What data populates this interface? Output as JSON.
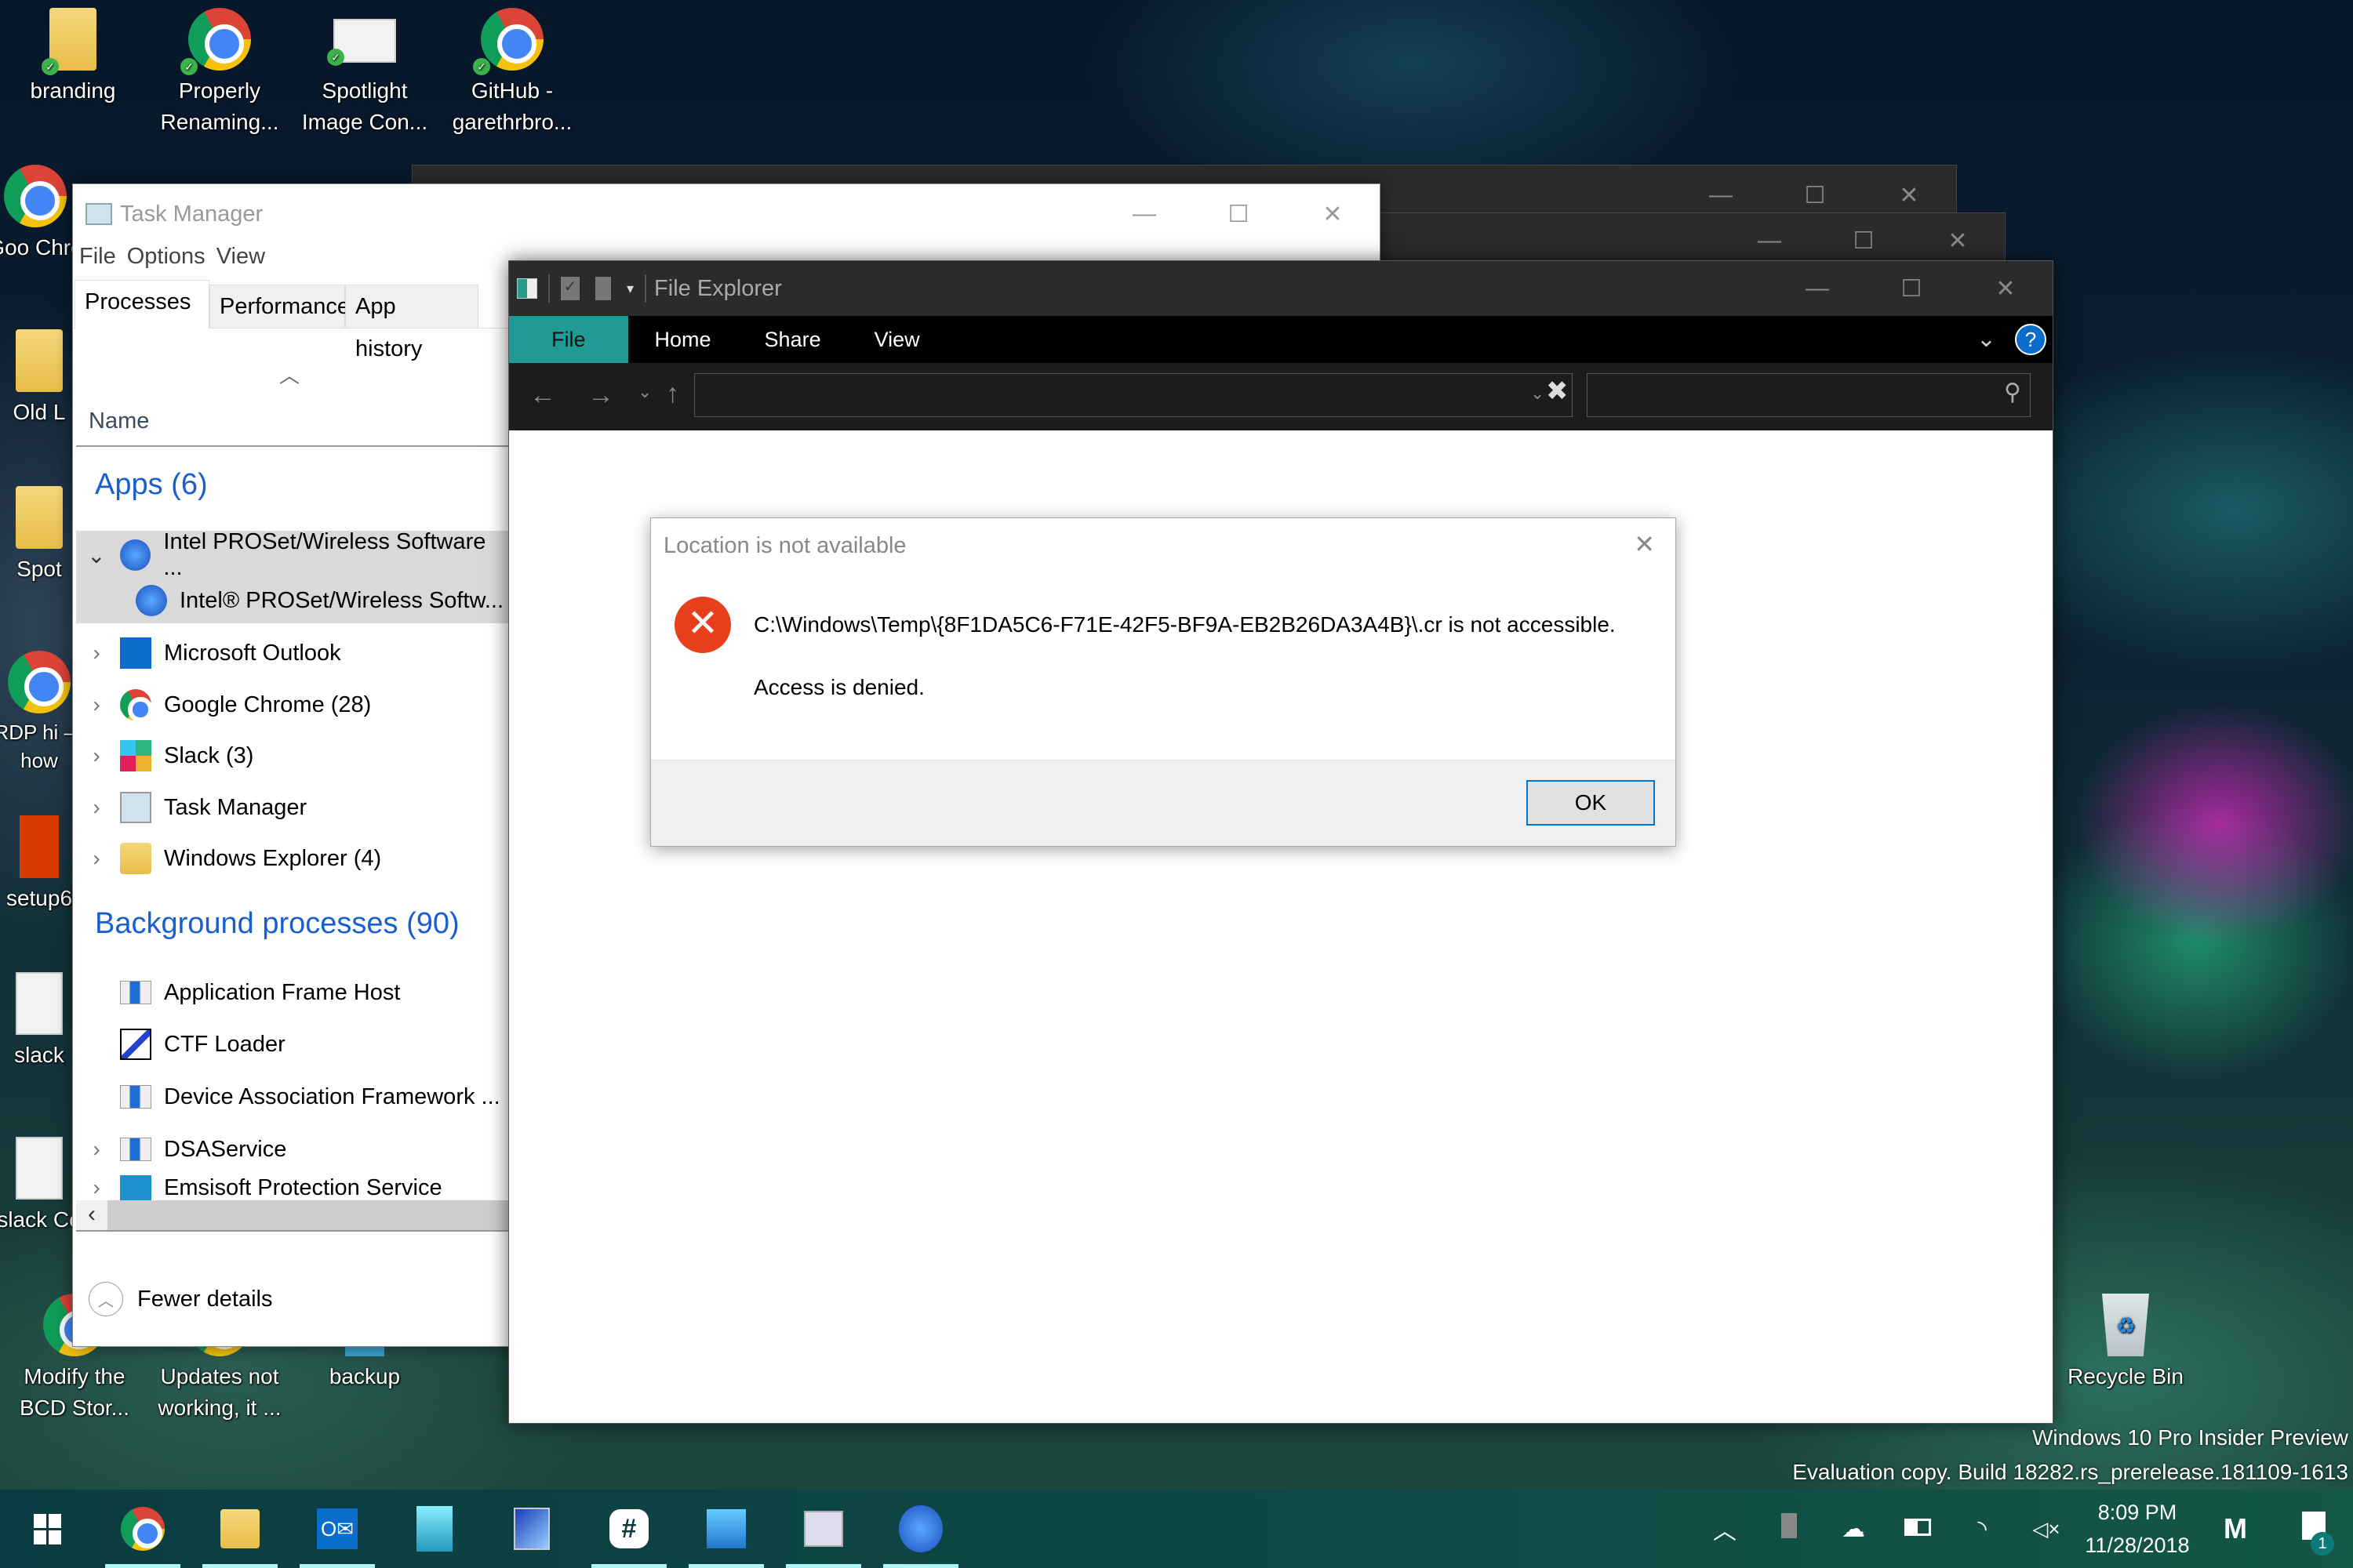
{
  "desktop": {
    "icons_top": [
      {
        "label": "branding",
        "icon": "folder-icon"
      },
      {
        "label": "Properly Renaming...",
        "icon": "chrome-icon"
      },
      {
        "label": "Spotlight Image Con...",
        "icon": "app-icon"
      },
      {
        "label": "GitHub - garethrbro...",
        "icon": "chrome-icon"
      }
    ],
    "icons_left": [
      {
        "label": "Goo Chro",
        "icon": "chrome-shortcut-icon"
      },
      {
        "label": "Old L",
        "icon": "folder-icon"
      },
      {
        "label": "Spot",
        "icon": "folder-icon"
      },
      {
        "label": "RDP hi — how",
        "icon": "chrome-icon"
      },
      {
        "label": "setup6",
        "icon": "office-icon"
      },
      {
        "label": "slack",
        "icon": "document-icon"
      },
      {
        "label": "slack Co",
        "icon": "document-icon"
      }
    ],
    "icons_bottom": [
      {
        "label": "Modify the BCD Stor...",
        "icon": "chrome-icon"
      },
      {
        "label": "Updates not working, it ...",
        "icon": "chrome-icon"
      },
      {
        "label": "backup",
        "icon": "server-icon"
      }
    ],
    "recycle_bin": {
      "label": "Recycle Bin"
    },
    "watermark": {
      "line1": "Windows 10 Pro Insider Preview",
      "line2": "Evaluation copy. Build 18282.rs_prerelease.181109-1613"
    }
  },
  "task_manager": {
    "title": "Task Manager",
    "menu": [
      "File",
      "Options",
      "View"
    ],
    "tabs": [
      "Processes",
      "Performance",
      "App history"
    ],
    "active_tab": "Processes",
    "column_name": "Name",
    "apps_group": "Apps (6)",
    "apps": [
      {
        "name": "Intel PROSet/Wireless Software ...",
        "icon": "wifi-icon",
        "expanded": true
      },
      {
        "name": "Intel® PROSet/Wireless Softw...",
        "icon": "wifi-icon",
        "child": true
      },
      {
        "name": "Microsoft Outlook",
        "icon": "outlook-icon"
      },
      {
        "name": "Google Chrome (28)",
        "icon": "chrome-icon"
      },
      {
        "name": "Slack (3)",
        "icon": "slack-icon"
      },
      {
        "name": "Task Manager",
        "icon": "task-manager-icon"
      },
      {
        "name": "Windows Explorer (4)",
        "icon": "explorer-icon"
      }
    ],
    "background_group": "Background processes (90)",
    "background": [
      {
        "name": "Application Frame Host",
        "icon": "window-icon",
        "expandable": false
      },
      {
        "name": "CTF Loader",
        "icon": "ctf-icon",
        "expandable": false
      },
      {
        "name": "Device Association Framework ...",
        "icon": "window-icon",
        "expandable": false
      },
      {
        "name": "DSAService",
        "icon": "window-icon",
        "expandable": true
      },
      {
        "name": "Emsisoft Protection Service",
        "icon": "shield-icon",
        "expandable": true
      }
    ],
    "fewer_details": "Fewer details"
  },
  "file_explorer": {
    "title": "File Explorer",
    "ribbon_tabs": [
      "File",
      "Home",
      "Share",
      "View"
    ],
    "address_value": "",
    "search_placeholder": ""
  },
  "dialog": {
    "title": "Location is not available",
    "message": "C:\\Windows\\Temp\\{8F1DA5C6-F71E-42F5-BF9A-EB2B26DA3A4B}\\.cr is not accessible.",
    "detail": "Access is denied.",
    "ok_label": "OK"
  },
  "taskbar": {
    "pinned": [
      {
        "name": "start",
        "icon": "windows-logo-icon",
        "running": false
      },
      {
        "name": "chrome",
        "icon": "chrome-icon",
        "running": true
      },
      {
        "name": "file-explorer",
        "icon": "folder-icon",
        "running": true
      },
      {
        "name": "outlook",
        "icon": "outlook-icon",
        "running": true
      },
      {
        "name": "buildings-app",
        "icon": "buildings-icon",
        "running": false
      },
      {
        "name": "remote-desktop",
        "icon": "remote-desktop-icon",
        "running": false
      },
      {
        "name": "slack",
        "icon": "slack-icon",
        "running": true
      },
      {
        "name": "control-panel",
        "icon": "control-panel-icon",
        "running": true
      },
      {
        "name": "task-manager",
        "icon": "task-manager-icon",
        "running": true
      },
      {
        "name": "intel-wireless",
        "icon": "wifi-icon",
        "running": true
      }
    ],
    "clock": {
      "time": "8:09 PM",
      "date": "11/28/2018"
    },
    "notification_count": "1"
  },
  "colors": {
    "accent_teal": "#1f9a94",
    "group_blue": "#1a5fd0",
    "error_red": "#e8401c",
    "ok_border": "#0078d7"
  }
}
